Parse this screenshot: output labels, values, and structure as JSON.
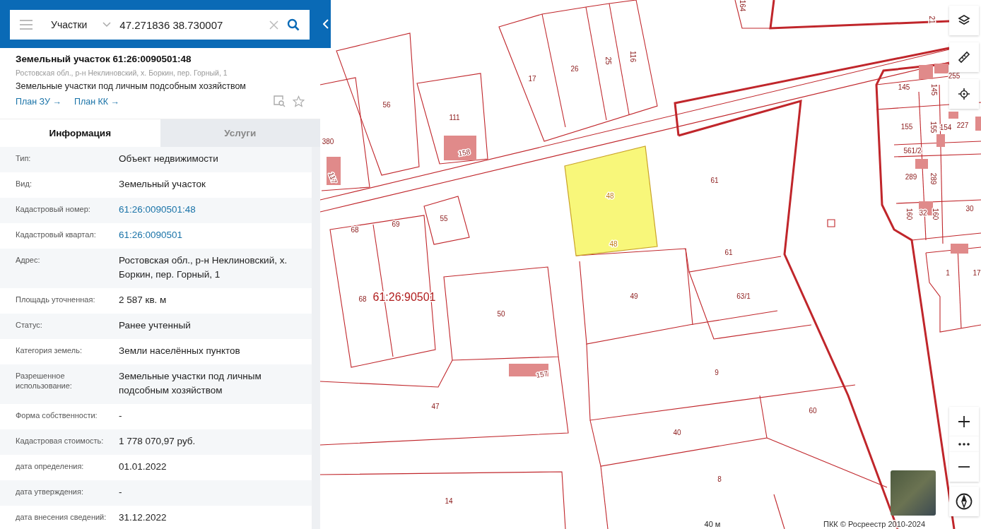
{
  "search": {
    "layer_select": "Участки",
    "query": "47.271836 38.730007"
  },
  "object": {
    "title": "Земельный участок 61:26:0090501:48",
    "address": "Ростовская обл., р-н Неклиновский, х. Боркин, пер. Горный, 1",
    "usage": "Земельные участки под личным подсобным хозяйством",
    "links": [
      "План ЗУ →",
      "План КК →"
    ]
  },
  "tabs": [
    {
      "label": "Информация",
      "selected": true
    },
    {
      "label": "Услуги",
      "selected": false
    }
  ],
  "rows": [
    {
      "label": "Тип:",
      "value": "Объект недвижимости",
      "kind": "text"
    },
    {
      "label": "Вид:",
      "value": "Земельный участок",
      "kind": "text"
    },
    {
      "label": "Кадастровый номер:",
      "value": "61:26:0090501:48",
      "kind": "link"
    },
    {
      "label": "Кадастровый квартал:",
      "value": "61:26:0090501",
      "kind": "link"
    },
    {
      "label": "Адрес:",
      "value": "Ростовская обл., р-н Неклиновский, х. Боркин, пер. Горный, 1",
      "kind": "text"
    },
    {
      "label": "Площадь уточненная:",
      "value": "2 587 кв. м",
      "kind": "text"
    },
    {
      "label": "Статус:",
      "value": "Ранее учтенный",
      "kind": "text"
    },
    {
      "label": "Категория земель:",
      "value": "Земли населённых пунктов",
      "kind": "text"
    },
    {
      "label": "Разрешенное использование:",
      "value": "Земельные участки под личным подсобным хозяйством",
      "kind": "text"
    },
    {
      "label": "Форма собственности:",
      "value": "-",
      "kind": "text"
    },
    {
      "label": "Кадастровая стоимость:",
      "value": "1 778 070,97 руб.",
      "kind": "text"
    },
    {
      "label": "дата определения:",
      "value": "01.01.2022",
      "kind": "text"
    },
    {
      "label": "дата утверждения:",
      "value": "-",
      "kind": "text"
    },
    {
      "label": "дата внесения сведений:",
      "value": "31.12.2022",
      "kind": "text"
    }
  ],
  "map": {
    "parcel_numbers": [
      "164",
      "21",
      "17",
      "26",
      "25",
      "116",
      "56",
      "111",
      "158",
      "380",
      "117",
      "145",
      "145",
      "255",
      "155",
      "155",
      "154",
      "227",
      "561/2",
      "289",
      "289",
      "160",
      "32",
      "160",
      "30",
      "1",
      "17",
      "48",
      "48",
      "61",
      "61",
      "55",
      "68",
      "69",
      "68",
      "50",
      "49",
      "63/1",
      "9",
      "157",
      "47",
      "60",
      "40",
      "8",
      "14"
    ],
    "quarter_label": "61:26:90501",
    "scale": "40 м",
    "attribution": "ПКК © Росреестр 2010-2024"
  }
}
